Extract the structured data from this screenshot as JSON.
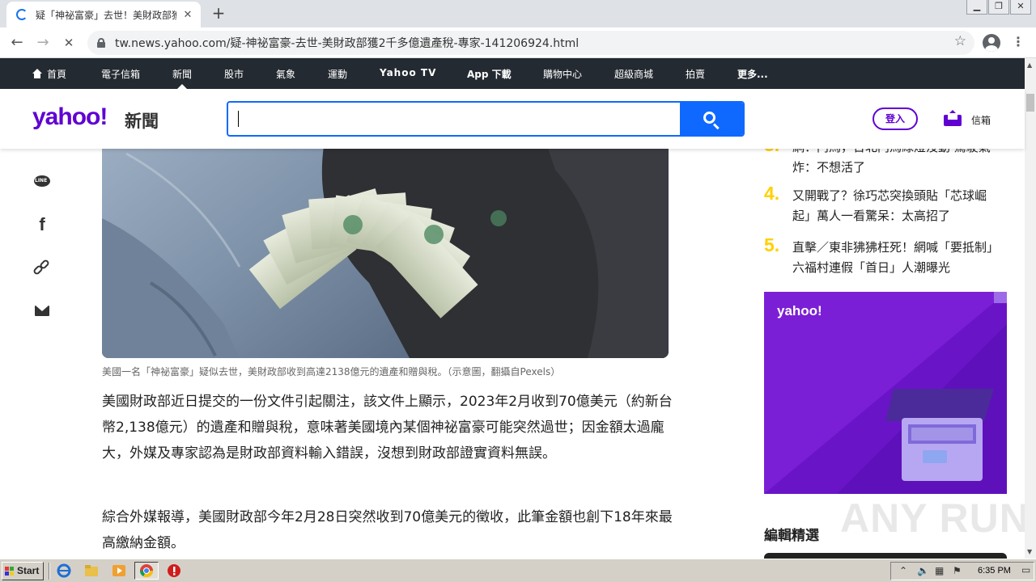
{
  "browser": {
    "tab_title": "疑「神祕富豪」去世！美財政部獲2千",
    "tab_close": "✕",
    "new_tab": "+",
    "url": "tw.news.yahoo.com/疑-神祕富豪-去世-美財政部獲2千多億遺產稅-專家-141206924.html",
    "back": "←",
    "forward": "→",
    "stop": "✕",
    "bookmark_star": "☆",
    "menu": "⋮"
  },
  "yahoo_nav": {
    "items": [
      "首頁",
      "電子信箱",
      "新聞",
      "股市",
      "氣象",
      "運動",
      "Yahoo TV",
      "App 下載",
      "購物中心",
      "超級商城",
      "拍賣",
      "更多..."
    ],
    "active": "新聞"
  },
  "header": {
    "logo": "yahoo!",
    "logo_sub": "新聞",
    "search_placeholder": "",
    "login_label": "登入",
    "mail_label": "信箱"
  },
  "article": {
    "caption": "美國一名「神祕富豪」疑似去世，美財政部收到高達2138億元的遺產和贈與稅。（示意圖，翻攝自Pexels）",
    "paragraphs": [
      "美國財政部近日提交的一份文件引起關注，該文件上顯示，2023年2月收到70億美元（約新台幣2,138億元）的遺產和贈與稅，意味著美國境內某個神祕富豪可能突然過世；因金額太過龐大，外媒及專家認為是財政部資料輸入錯誤，沒想到財政部證實資料無誤。",
      "綜合外媒報導，美國財政部今年2月28日突然收到70億美元的徵收，此筆金額也創下18年來最高繳納金額。"
    ]
  },
  "share": {
    "line_label": "LINE"
  },
  "trending": [
    {
      "num": "3.",
      "text": "網：鬥馬，台北鬥馬綠燈沒動 駕駛氣炸：不想活了"
    },
    {
      "num": "4.",
      "text": "又開戰了？徐巧芯突換頭貼「芯球崛起」萬人一看驚呆：太高招了"
    },
    {
      "num": "5.",
      "text": "直擊／東非狒狒枉死！網喊「要抵制」六福村連假「首日」人潮曝光"
    }
  ],
  "ad": {
    "logo": "yahoo!"
  },
  "editor_picks": {
    "title": "編輯精選"
  },
  "watermark": "ANY RUN",
  "taskbar": {
    "start_label": "Start",
    "clock": "6:35 PM"
  },
  "colors": {
    "yahoo_purple": "#6001d2",
    "search_blue": "#0f69ff",
    "nav_dark": "#232a31",
    "trend_yellow": "#ffd000",
    "ad_purple": "#7b1fd6"
  }
}
